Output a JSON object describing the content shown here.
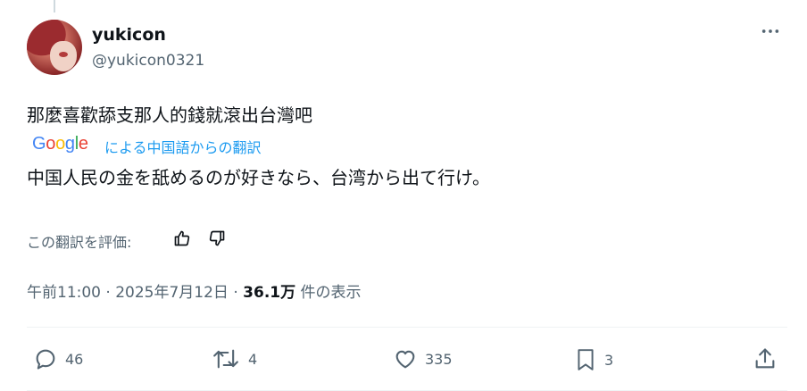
{
  "author": {
    "display_name": "yukicon",
    "handle": "@yukicon0321"
  },
  "more_icon": "more-horizontal-icon",
  "post": {
    "original_text": "那麼喜歡舔支那人的錢就滾出台灣吧",
    "translation_provider": "Google",
    "translation_label": "による中国語からの翻訳",
    "translated_text": "中国人民の金を舐めるのが好きなら、台湾から出て行け。"
  },
  "rating": {
    "label": "この翻訳を評価:",
    "icons": [
      "thumbs-up-icon",
      "thumbs-down-icon"
    ]
  },
  "meta": {
    "time": "午前11:00",
    "sep1": " · ",
    "date": "2025年7月12日",
    "sep2": " · ",
    "views": "36.1万",
    "views_label": " 件の表示"
  },
  "actions": {
    "replies": "46",
    "reposts": "4",
    "likes": "335",
    "bookmarks": "3"
  },
  "colors": {
    "accent": "#1d9bf0",
    "secondary_text": "#536471",
    "primary_text": "#0f1419"
  }
}
